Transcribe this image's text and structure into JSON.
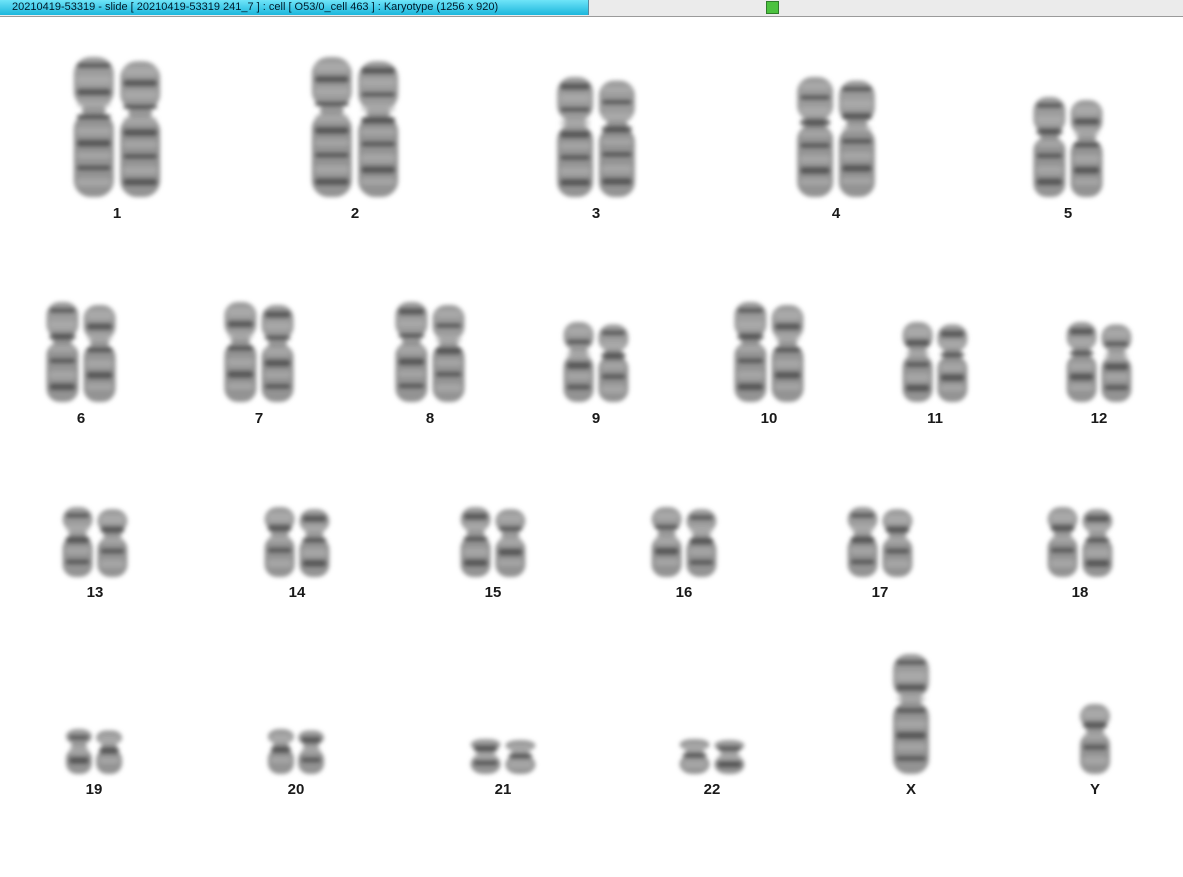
{
  "window": {
    "title": "20210419-53319 - slide [ 20210419-53319 241_7 ] : cell [ O53/0_cell 463 ] : Karyotype  (1256 x 920)",
    "status_color": "#4cc23f"
  },
  "karyotype": {
    "rows": [
      [
        {
          "id": "1",
          "label": "1",
          "copies": 2,
          "length": "xl"
        },
        {
          "id": "2",
          "label": "2",
          "copies": 2,
          "length": "xl"
        },
        {
          "id": "3",
          "label": "3",
          "copies": 2,
          "length": "l"
        },
        {
          "id": "4",
          "label": "4",
          "copies": 2,
          "length": "l"
        },
        {
          "id": "5",
          "label": "5",
          "copies": 2,
          "length": "m"
        }
      ],
      [
        {
          "id": "6",
          "label": "6",
          "copies": 2,
          "length": "m"
        },
        {
          "id": "7",
          "label": "7",
          "copies": 2,
          "length": "m"
        },
        {
          "id": "8",
          "label": "8",
          "copies": 2,
          "length": "m"
        },
        {
          "id": "9",
          "label": "9",
          "copies": 2,
          "length": "s"
        },
        {
          "id": "10",
          "label": "10",
          "copies": 2,
          "length": "m"
        },
        {
          "id": "11",
          "label": "11",
          "copies": 2,
          "length": "s"
        },
        {
          "id": "12",
          "label": "12",
          "copies": 2,
          "length": "s"
        }
      ],
      [
        {
          "id": "13",
          "label": "13",
          "copies": 2,
          "length": "xs"
        },
        {
          "id": "14",
          "label": "14",
          "copies": 2,
          "length": "xs"
        },
        {
          "id": "15",
          "label": "15",
          "copies": 2,
          "length": "xs"
        },
        {
          "id": "16",
          "label": "16",
          "copies": 2,
          "length": "xs"
        },
        {
          "id": "17",
          "label": "17",
          "copies": 2,
          "length": "xs"
        },
        {
          "id": "18",
          "label": "18",
          "copies": 2,
          "length": "xs"
        }
      ],
      [
        {
          "id": "19",
          "label": "19",
          "copies": 2,
          "length": "xxs"
        },
        {
          "id": "20",
          "label": "20",
          "copies": 2,
          "length": "xxs"
        },
        {
          "id": "21",
          "label": "21",
          "copies": 2,
          "length": "tiny"
        },
        {
          "id": "22",
          "label": "22",
          "copies": 2,
          "length": "tiny"
        },
        {
          "id": "X",
          "label": "X",
          "copies": 1,
          "length": "l"
        },
        {
          "id": "Y",
          "label": "Y",
          "copies": 1,
          "length": "xs"
        }
      ]
    ]
  }
}
